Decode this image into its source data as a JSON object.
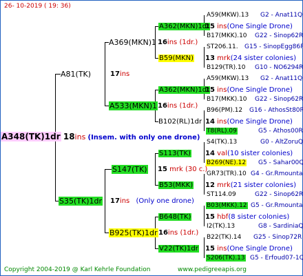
{
  "header": {
    "date": "26- 10-2019 ( 19: 36)"
  },
  "root": {
    "name": "A348(TK)1dr",
    "gen": "18",
    "ins": "ins",
    "comment": "(Insem. with only one drone)"
  },
  "g1": [
    {
      "name": "A81(TK)",
      "gen": "17",
      "ins": "ins",
      "comment": ""
    },
    {
      "name": "S35(TK)1dr",
      "gen": "17",
      "ins": "ins",
      "comment": "(Only one drone)"
    }
  ],
  "g2": [
    {
      "name": "A369(MKN)1",
      "gen": "16",
      "ins": "ins",
      "comment": "(1dr.)"
    },
    {
      "name": "A533(MKN)1",
      "gen": "16",
      "ins": "ins",
      "comment": "(1dr.)"
    },
    {
      "name": "S147(TK)",
      "gen": "15",
      "ins": "mrk",
      "comment": "(30 c.)"
    },
    {
      "name": "B925(TK)1dr",
      "gen": "16",
      "ins": "ins",
      "comment": "(1dr.)"
    }
  ],
  "g3": [
    {
      "name": "A362(MKN)1dr",
      "gen": "15",
      "ins": "ins",
      "comment": "(One Single Drone)"
    },
    {
      "name": "B59(MKN)",
      "gen": "13",
      "ins": "mrk",
      "comment": "(24 sister colonies)"
    },
    {
      "name": "A362(MKN)1dr",
      "gen": "15",
      "ins": "ins",
      "comment": "(One Single Drone)"
    },
    {
      "name": "B102(RL)1dr",
      "gen": "14",
      "ins": "ins",
      "comment": "(One Single Drone)"
    },
    {
      "name": "S113(TK)",
      "gen": "14",
      "ins": "val",
      "comment": "(10 sister colonies)"
    },
    {
      "name": "B53(MKK)",
      "gen": "12",
      "ins": "mrk",
      "comment": "(21 sister colonies)"
    },
    {
      "name": "B648(TK)",
      "gen": "15",
      "ins": "hbf",
      "comment": "(8 sister colonies)"
    },
    {
      "name": "V22(TK)1dr",
      "gen": "15",
      "ins": "ins",
      "comment": "(One Single Drone)"
    }
  ],
  "g4": [
    {
      "name": "A59(MKW).13",
      "ref": "G2 - Anat11Q"
    },
    {
      "name": "B17(MKK).10",
      "ref": "G22 - Sinop62R"
    },
    {
      "name": "ST206.11.",
      "ref": "G15 - SinopEgg86R"
    },
    {
      "name": "B129(TR).10",
      "ref": "G10 - NO6294R"
    },
    {
      "name": "A59(MKW).13",
      "ref": "G2 - Anat11Q"
    },
    {
      "name": "B17(MKK).10",
      "ref": "G22 - Sinop62R"
    },
    {
      "name": "B96(PM).12",
      "ref": "G16 - AthosSt80R"
    },
    {
      "name": "T8(RL).09",
      "ref": "G5 - Athos00R"
    },
    {
      "name": "S4(TK).13",
      "ref": "G0 - AltZoruQ"
    },
    {
      "name": "B269(NE).12",
      "ref": "G5 - Sahar00Q"
    },
    {
      "name": "GR73(TR).10",
      "ref": "G4 - Gr.Rmounta"
    },
    {
      "name": "ST114.09",
      "ref": "G22 - Sinop62R"
    },
    {
      "name": "B03(MKK).12",
      "ref": "G5 - Gr.Rmounta"
    },
    {
      "name": "I2(TK).13",
      "ref": "G8 - SardiniaQ"
    },
    {
      "name": "B22(TK).14",
      "ref": "G25 - Sinop72R"
    },
    {
      "name": "S206(TK).13",
      "ref": "G5 - Erfoud07-1Q"
    }
  ],
  "footer": {
    "copyright": "Copyright 2004-2019 @ Karl Kehrle Foundation",
    "site": "www.pedigreeapis.org"
  }
}
